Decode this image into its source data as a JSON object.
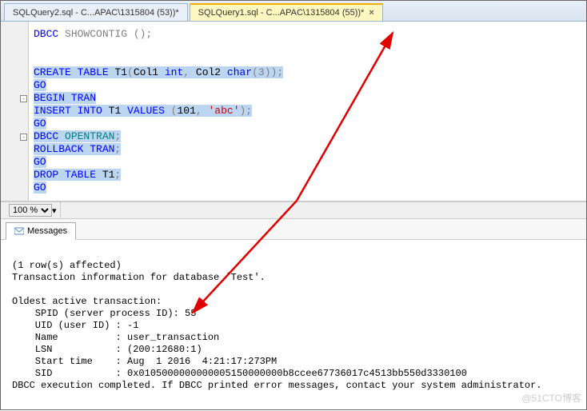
{
  "tabs": [
    {
      "label": "SQLQuery2.sql - C...APAC\\1315804 (53))*",
      "active": false
    },
    {
      "label": "SQLQuery1.sql - C...APAC\\1315804 (55))*",
      "active": true
    }
  ],
  "code": {
    "line1_kw": "DBCC",
    "line1_fn": "SHOWCONTIG ",
    "line1_paren": "();",
    "l_create": "CREATE",
    "l_table": "TABLE",
    "l_t1def": " T1",
    "l_paren_open": "(",
    "l_col1": "Col1 ",
    "l_int": "int",
    "l_comma": ", ",
    "l_col2": "Col2 ",
    "l_char": "char",
    "l_char_args": "(3));",
    "go": "GO",
    "begin_tran": "BEGIN TRAN",
    "insert": "INSERT",
    "into": "INTO",
    "t1vals": " T1 ",
    "values_kw": "VALUES ",
    "values_args_open": "(",
    "values_num": "101",
    "values_comma": ", ",
    "values_str": "'abc'",
    "values_close": ");",
    "dbcc": "DBCC",
    "opentran": "OPENTRAN",
    "semicolon": ";",
    "rollback": "ROLLBACK TRAN",
    "drop": "DROP TABLE",
    "drop_t1": " T1"
  },
  "zoom": {
    "value": "100 %",
    "options": [
      "100 %"
    ]
  },
  "messages": {
    "tab_label": "Messages",
    "body": "\n(1 row(s) affected)\nTransaction information for database 'Test'.\n\nOldest active transaction:\n    SPID (server process ID): 55\n    UID (user ID) : -1\n    Name          : user_transaction\n    LSN           : (200:12680:1)\n    Start time    : Aug  1 2016  4:21:17:273PM\n    SID           : 0x0105000000000005150000000b8ccee67736017c4513bb550d3330100\nDBCC execution completed. If DBCC printed error messages, contact your system administrator."
  },
  "watermark": "@51CTO博客"
}
